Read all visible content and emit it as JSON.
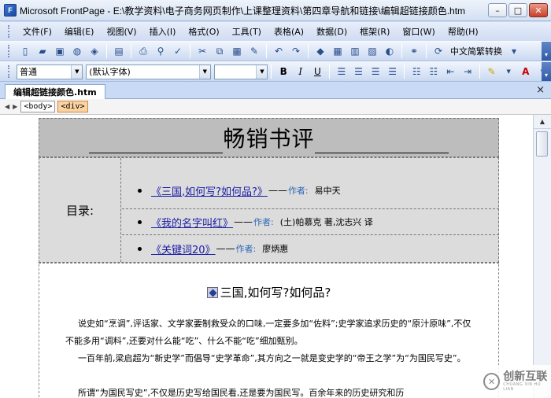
{
  "window": {
    "title": "Microsoft FrontPage - E:\\教学资料\\电子商务网页制作\\上课整理资料\\第四章导航和链接\\编辑超链接颜色.htm",
    "minimize": "–",
    "restore": "□",
    "close": "✕"
  },
  "menu": [
    "文件(F)",
    "编辑(E)",
    "视图(V)",
    "插入(I)",
    "格式(O)",
    "工具(T)",
    "表格(A)",
    "数据(D)",
    "框架(R)",
    "窗口(W)",
    "帮助(H)"
  ],
  "toolbar1": {
    "chinese_convert": "中文简繁转换"
  },
  "toolbar2": {
    "style_value": "普通",
    "font_value": "(默认字体)",
    "size_value": "",
    "bold": "B",
    "italic": "I",
    "underline": "U"
  },
  "document": {
    "tab_label": "编辑超链接颜色.htm",
    "close": "×",
    "tags": [
      "<body>",
      "<div>"
    ]
  },
  "page": {
    "header_title": "畅销书评",
    "toc_label": "目录:",
    "toc": [
      {
        "link": "《三国,如何写?如何品?》",
        "dash": "——",
        "author_label": "作者:",
        "author": "易中天"
      },
      {
        "link": "《我的名字叫红》",
        "dash": "——",
        "author_label": "作者:",
        "author": "(土)帕慕克 著,沈志兴 译"
      },
      {
        "link": "《关键词20》",
        "dash": "——",
        "author_label": "作者:",
        "author": "廖炳惠"
      }
    ],
    "section_title": "三国,如何写?如何品?",
    "paragraphs": [
      "说史如“烹调”,评话家、文学家要制救受众的口味,一定要多加“佐料”;史学家追求历史的“原汁原味”,不仅不能多用“调料”,还要对什么能“吃”、什么不能“吃”细加甄别。",
      "一百年前,梁启超为“新史学”而倡导“史学革命”,其方向之一就是变史学的“帝王之学”为“为国民写史”。",
      "所谓“为国民写史”,不仅是历史写给国民看,还是要为国民写。百余年来的历史研究和历"
    ]
  },
  "watermark": {
    "text": "创新互联",
    "sub": "CHUANG XIN HU LIAN"
  }
}
